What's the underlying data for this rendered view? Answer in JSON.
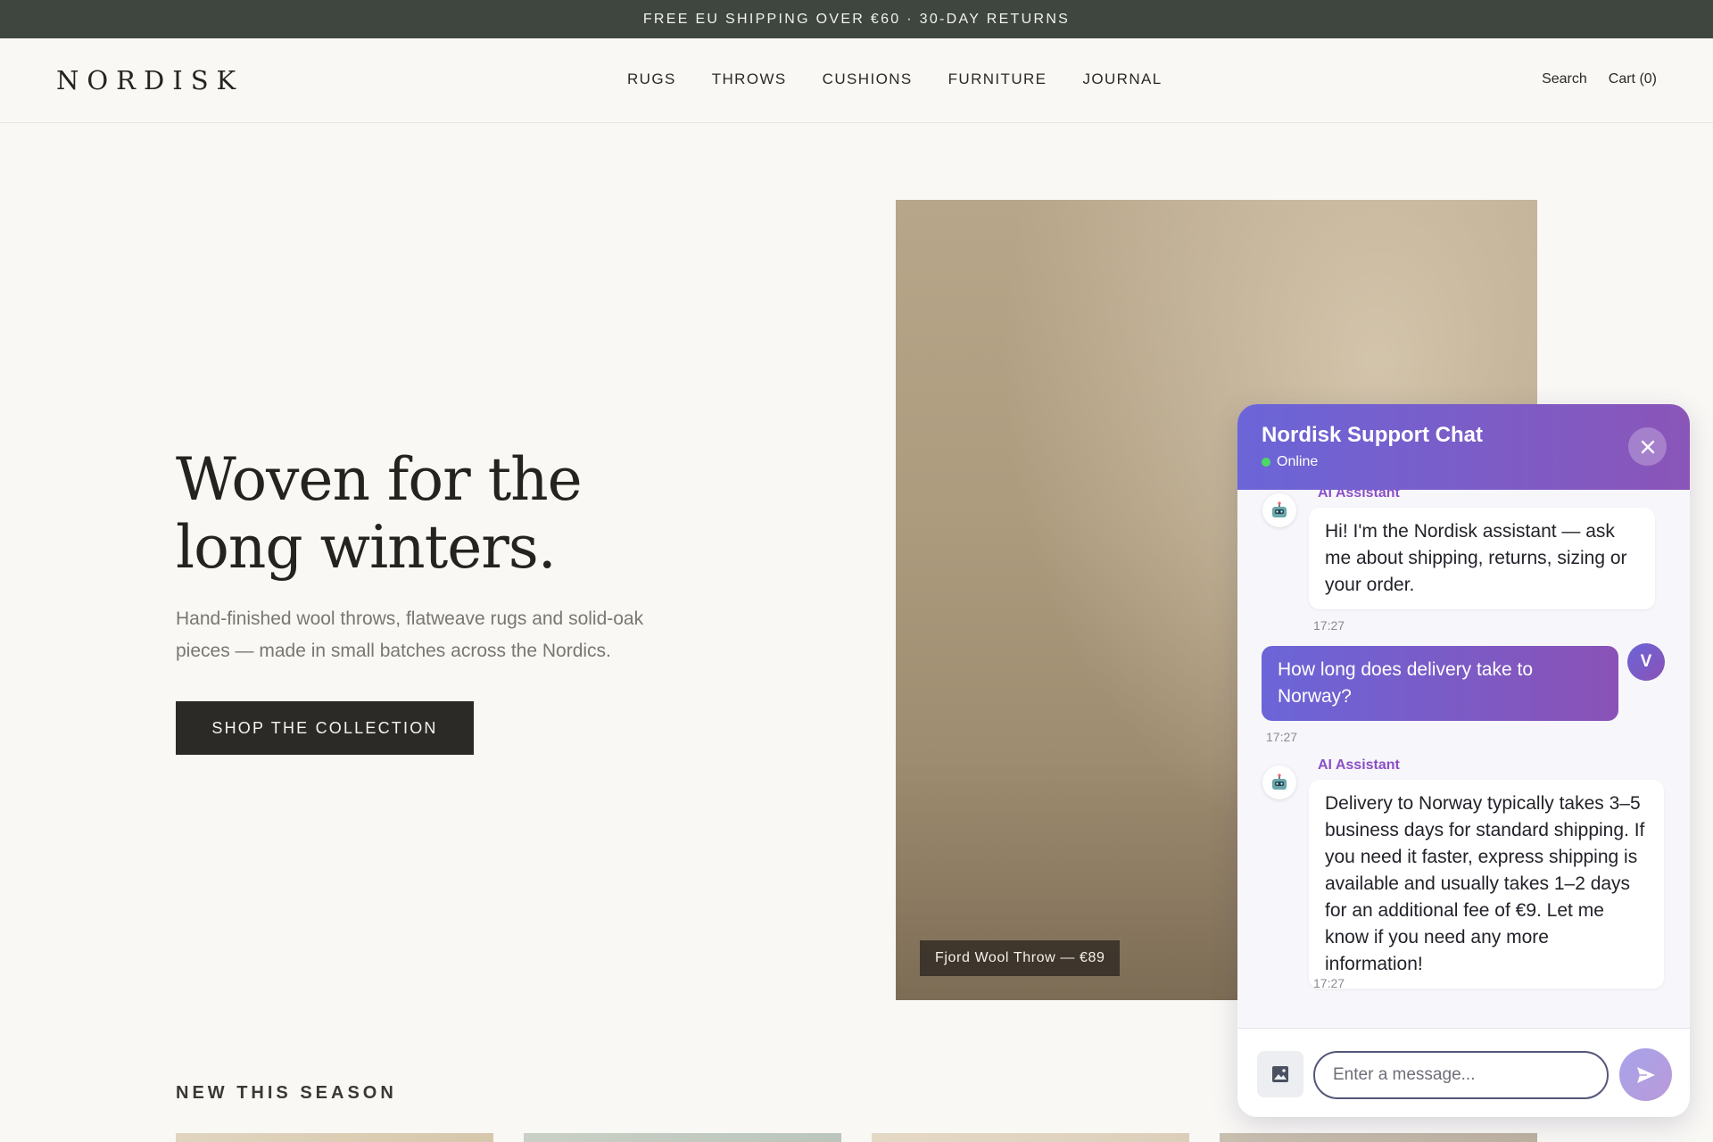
{
  "announcement": "FREE EU SHIPPING OVER €60 · 30-DAY RETURNS",
  "header": {
    "logo": "NORDISK",
    "nav": [
      "RUGS",
      "THROWS",
      "CUSHIONS",
      "FURNITURE",
      "JOURNAL"
    ],
    "search": "Search",
    "cart": "Cart (0)"
  },
  "hero": {
    "title_line1": "Woven for the",
    "title_line2": "long winters.",
    "subtitle": "Hand-finished wool throws, flatweave rugs and solid-oak pieces — made in small batches across the Nordics.",
    "cta": "SHOP THE COLLECTION",
    "image_caption": "Fjord Wool Throw — €89"
  },
  "section": {
    "title": "NEW THIS SEASON"
  },
  "colors": {
    "announce_bg": "#3e463f",
    "accent_start": "#6b65d8",
    "accent_end": "#8a55b8",
    "online": "#4cd964"
  },
  "chat": {
    "title": "Nordisk Support Chat",
    "status": "Online",
    "messages": [
      {
        "sender": "AI Assistant",
        "text": "Hi! I'm the Nordisk assistant — ask me about shipping, returns, sizing or your order.",
        "time": "17:27"
      },
      {
        "sender": "V",
        "text": "How long does delivery take to Norway?",
        "time": "17:27"
      },
      {
        "sender": "AI Assistant",
        "text": "Delivery to Norway typically takes 3–5 business days for standard shipping. If you need it faster, express shipping is available and usually takes 1–2 days for an additional fee of €9. Let me know if you need any more information!",
        "time": "17:27"
      }
    ],
    "input_placeholder": "Enter a message..."
  }
}
